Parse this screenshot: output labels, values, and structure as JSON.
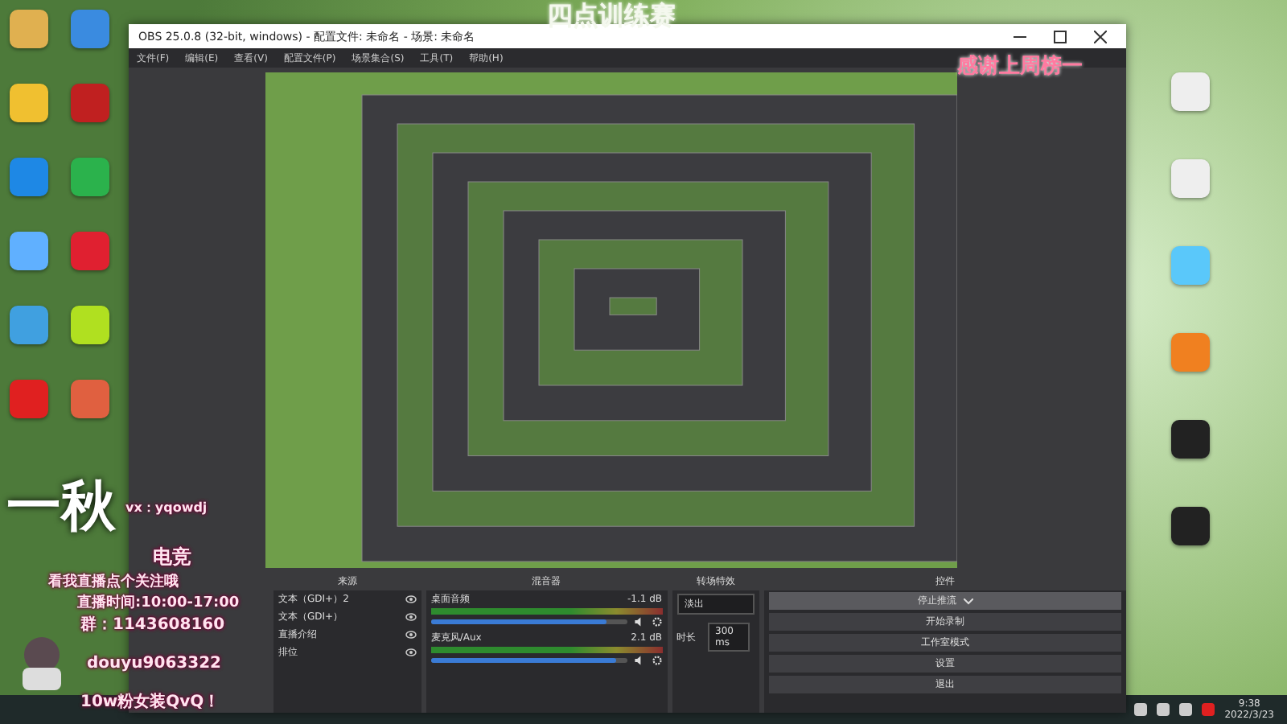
{
  "banner": {
    "title": "四点训练赛",
    "thanks": "感谢上周榜一"
  },
  "obs": {
    "title": "OBS 25.0.8 (32-bit, windows) - 配置文件: 未命名 - 场景: 未命名",
    "menu": [
      "文件(F)",
      "编辑(E)",
      "查看(V)",
      "配置文件(P)",
      "场景集合(S)",
      "工具(T)",
      "帮助(H)"
    ],
    "sources": {
      "title": "来源",
      "items": [
        {
          "name": "文本（GDI+）2"
        },
        {
          "name": "文本（GDI+）"
        },
        {
          "name": "直播介绍"
        },
        {
          "name": "排位"
        }
      ]
    },
    "mixer": {
      "title": "混音器",
      "channels": [
        {
          "name": "桌面音频",
          "reading": "-1.1 dB",
          "level": 0.9
        },
        {
          "name": "麦克风/Aux",
          "reading": "2.1 dB",
          "level": 0.95
        }
      ]
    },
    "transitions": {
      "title": "转场特效",
      "type": "淡出",
      "duration_label": "时长",
      "duration": "300 ms"
    },
    "controls": {
      "title": "控件",
      "buttons": [
        {
          "label": "停止推流",
          "kind": "dropdown"
        },
        {
          "label": "开始录制",
          "kind": "plain"
        },
        {
          "label": "工作室模式",
          "kind": "plain"
        },
        {
          "label": "设置",
          "kind": "plain"
        },
        {
          "label": "退出",
          "kind": "plain"
        }
      ]
    }
  },
  "overlay": {
    "logo": "一秋",
    "wechat": "vx：yqowdj",
    "subtitle": "电竞",
    "follow": "看我直播点个关注哦",
    "schedule": "直播时间:10:00-17:00",
    "group": "群：1143608160",
    "douyu": "douyu9063322",
    "fans": "10w粉女装QvQ！"
  },
  "taskbar": {
    "time": "9:38",
    "date": "2022/3/23"
  }
}
